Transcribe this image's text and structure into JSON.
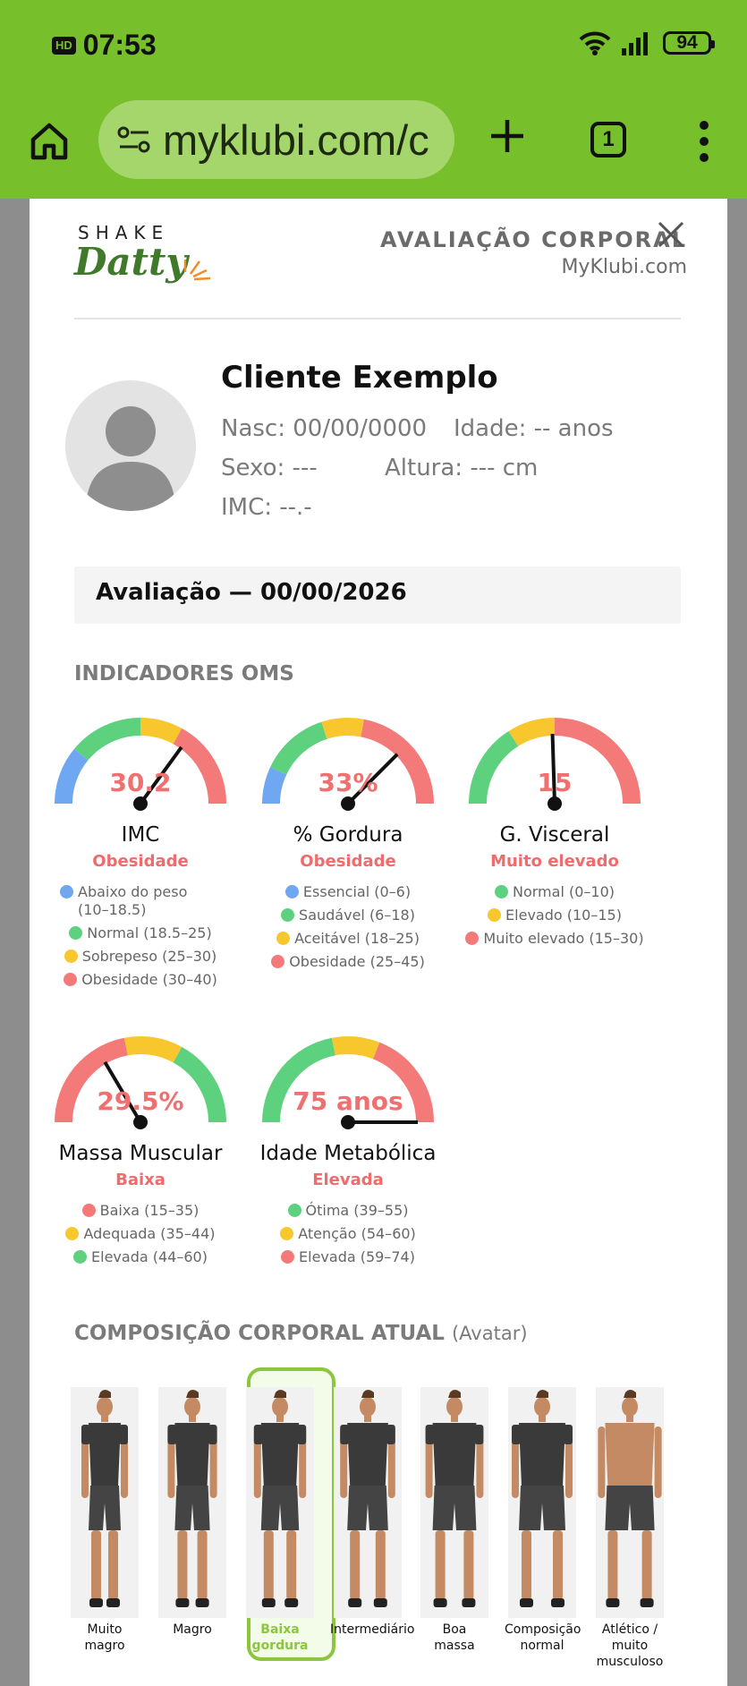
{
  "status_bar": {
    "hd": "HD",
    "time": "07:53",
    "battery": "94"
  },
  "browser": {
    "url": "myklubi.com/c",
    "tab_count": "1"
  },
  "header": {
    "logo_top": "SHAKE",
    "logo_script": "Datty",
    "title": "AVALIAÇÃO CORPORAL",
    "subtitle": "MyKlubi.com"
  },
  "client": {
    "name": "Cliente Exemplo",
    "birth": "Nasc: 00/00/0000",
    "age": "Idade: -- anos",
    "sex": "Sexo: ---",
    "height": "Altura: --- cm",
    "bmi": "IMC: --.-"
  },
  "evaluation": {
    "label": "Avaliação — 00/00/2026"
  },
  "indicators": {
    "section_title": "INDICADORES OMS",
    "gauges": [
      {
        "name": "IMC",
        "value": "30.2",
        "status": "Obesidade",
        "needle_fraction": 0.7,
        "segments": [
          {
            "color": "#6fa8f0",
            "fraction": 0.22
          },
          {
            "color": "#5ed17f",
            "fraction": 0.28
          },
          {
            "color": "#f8c72d",
            "fraction": 0.16
          },
          {
            "color": "#f47a7a",
            "fraction": 0.34
          }
        ],
        "legend": [
          {
            "label": "Abaixo do peso (10–18.5)",
            "color": "#6fa8f0"
          },
          {
            "label": "Normal (18.5–25)",
            "color": "#5ed17f"
          },
          {
            "label": "Sobrepeso (25–30)",
            "color": "#f8c72d"
          },
          {
            "label": "Obesidade (30–40)",
            "color": "#f47a7a"
          }
        ]
      },
      {
        "name": "% Gordura",
        "value": "33%",
        "status": "Obesidade",
        "needle_fraction": 0.75,
        "segments": [
          {
            "color": "#6fa8f0",
            "fraction": 0.14
          },
          {
            "color": "#5ed17f",
            "fraction": 0.26
          },
          {
            "color": "#f8c72d",
            "fraction": 0.16
          },
          {
            "color": "#f47a7a",
            "fraction": 0.44
          }
        ],
        "legend": [
          {
            "label": "Essencial (0–6)",
            "color": "#6fa8f0"
          },
          {
            "label": "Saudável (6–18)",
            "color": "#5ed17f"
          },
          {
            "label": "Aceitável (18–25)",
            "color": "#f8c72d"
          },
          {
            "label": "Obesidade (25–45)",
            "color": "#f47a7a"
          }
        ]
      },
      {
        "name": "G. Visceral",
        "value": "15",
        "status": "Muito elevado",
        "needle_fraction": 0.49,
        "segments": [
          {
            "color": "#5ed17f",
            "fraction": 0.32
          },
          {
            "color": "#f8c72d",
            "fraction": 0.18
          },
          {
            "color": "#f47a7a",
            "fraction": 0.5
          }
        ],
        "legend": [
          {
            "label": "Normal (0–10)",
            "color": "#5ed17f"
          },
          {
            "label": "Elevado (10–15)",
            "color": "#f8c72d"
          },
          {
            "label": "Muito elevado (15–30)",
            "color": "#f47a7a"
          }
        ]
      },
      {
        "name": "Massa Muscular",
        "value": "29.5%",
        "status": "Baixa",
        "needle_fraction": 0.33,
        "segments": [
          {
            "color": "#f47a7a",
            "fraction": 0.44
          },
          {
            "color": "#f8c72d",
            "fraction": 0.22
          },
          {
            "color": "#5ed17f",
            "fraction": 0.34
          }
        ],
        "legend": [
          {
            "label": "Baixa (15–35)",
            "color": "#f47a7a"
          },
          {
            "label": "Adequada (35–44)",
            "color": "#f8c72d"
          },
          {
            "label": "Elevada (44–60)",
            "color": "#5ed17f"
          }
        ]
      },
      {
        "name": "Idade Metabólica",
        "value": "75 anos",
        "status": "Elevada",
        "needle_fraction": 1.0,
        "segments": [
          {
            "color": "#5ed17f",
            "fraction": 0.44
          },
          {
            "color": "#f8c72d",
            "fraction": 0.18
          },
          {
            "color": "#f47a7a",
            "fraction": 0.38
          }
        ],
        "legend": [
          {
            "label": "Ótima (39–55)",
            "color": "#5ed17f"
          },
          {
            "label": "Atenção (54–60)",
            "color": "#f8c72d"
          },
          {
            "label": "Elevada (59–74)",
            "color": "#f47a7a"
          }
        ]
      }
    ]
  },
  "composition": {
    "section_title": "COMPOSIÇÃO CORPORAL ATUAL",
    "section_note": "(Avatar)",
    "selected_index": 2,
    "types": [
      {
        "label": "Muito magro",
        "skin": "shirt"
      },
      {
        "label": "Magro",
        "skin": "shirt"
      },
      {
        "label": "Baixa gordura",
        "skin": "shirt"
      },
      {
        "label": "Intermediário",
        "skin": "shirt"
      },
      {
        "label": "Boa massa",
        "skin": "shirt"
      },
      {
        "label": "Composição normal",
        "skin": "shirt"
      },
      {
        "label": "Atlético / muito musculoso",
        "skin": "bare"
      }
    ]
  }
}
